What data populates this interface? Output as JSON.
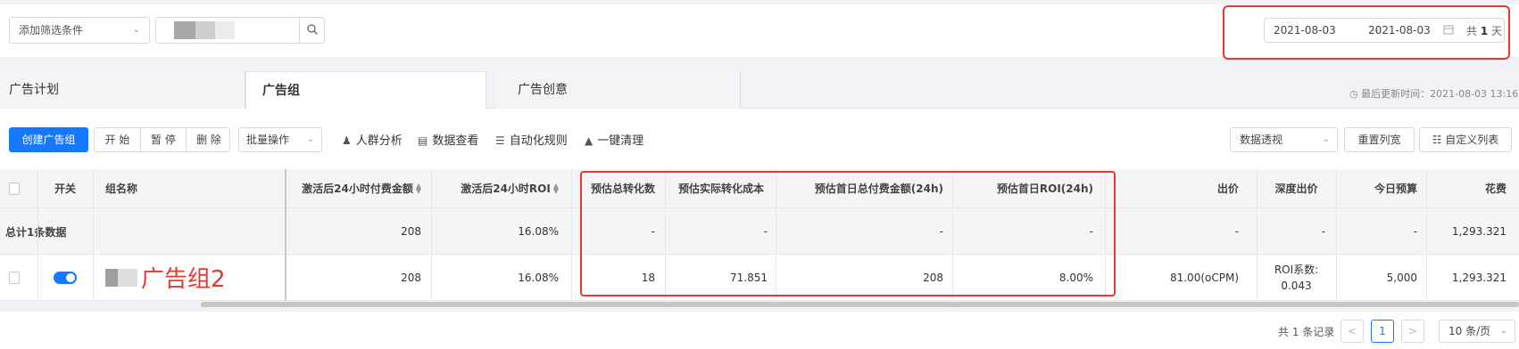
{
  "filter": {
    "add_filter_label": "添加筛选条件",
    "date_start": "2021-08-03",
    "date_arrow": "→",
    "date_end": "2021-08-03",
    "days_prefix": "共",
    "days_count": "1",
    "days_suffix": "天"
  },
  "tabs": [
    {
      "label": "广告计划"
    },
    {
      "label": "广告组"
    },
    {
      "label": "广告创意"
    }
  ],
  "last_update": "最后更新时间：2021-08-03 13:16",
  "toolbar": {
    "create_label": "创建广告组",
    "start_label": "开 始",
    "pause_label": "暂 停",
    "delete_label": "删 除",
    "batch_label": "批量操作",
    "crowd_label": "人群分析",
    "data_view_label": "数据查看",
    "auto_rule_label": "自动化规则",
    "clean_label": "一键清理",
    "pivot_label": "数据透视",
    "reset_columns_label": "重置列宽",
    "custom_columns_label": "自定义列表"
  },
  "table": {
    "headers": {
      "switch": "开关",
      "name": "组名称",
      "pay_24h": "激活后24小时付费金额",
      "roi_24h": "激活后24小时ROI",
      "est_conv": "预估总转化数",
      "est_cost": "预估实际转化成本",
      "est_first_day_pay": "预估首日总付费金额(24h)",
      "est_first_day_roi": "预估首日ROI(24h)",
      "bid": "出价",
      "deep_bid": "深度出价",
      "today_budget": "今日预算",
      "spend": "花费"
    },
    "total_row": {
      "label": "总计1条数据",
      "pay_24h": "208",
      "roi_24h": "16.08%",
      "est_conv": "-",
      "est_cost": "-",
      "est_first_day_pay": "-",
      "est_first_day_roi": "-",
      "bid": "-",
      "deep_bid": "-",
      "today_budget": "-",
      "spend": "1,293.321"
    },
    "data_row": {
      "name": "广告组2",
      "pay_24h": "208",
      "roi_24h": "16.08%",
      "est_conv": "18",
      "est_cost": "71.851",
      "est_first_day_pay": "208",
      "est_first_day_roi": "8.00%",
      "bid": "81.00(oCPM)",
      "deep_bid_line1": "ROI系数:",
      "deep_bid_line2": "0.043",
      "today_budget": "5,000",
      "spend": "1,293.321",
      "switch_on": true
    }
  },
  "pagination": {
    "total_label": "共 1 条记录",
    "prev": "<",
    "current_page": "1",
    "next": ">",
    "page_size": "10 条/页"
  },
  "colors": {
    "primary": "#1677ff",
    "highlight_red": "#e53935"
  }
}
